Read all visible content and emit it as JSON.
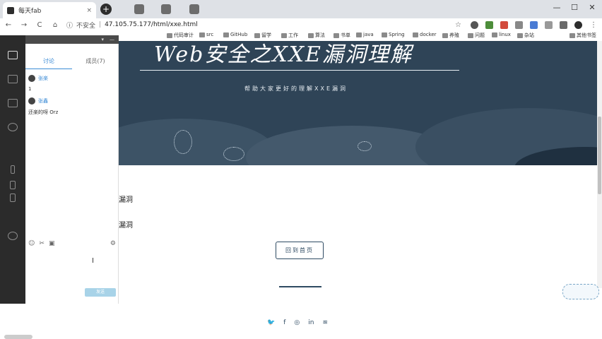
{
  "browser": {
    "tab_title": "每天fab",
    "tab_close": "×",
    "new_tab": "+",
    "window_minimize": "—",
    "window_maximize": "☐",
    "window_close": "✕",
    "nav_back": "←",
    "nav_forward": "→",
    "nav_reload": "C",
    "nav_home": "⌂",
    "security_label": "不安全",
    "url": "47.105.75.177/html/xxe.html"
  },
  "bookmarks": [
    {
      "label": "代码审计"
    },
    {
      "label": "src"
    },
    {
      "label": "GitHub"
    },
    {
      "label": "留学"
    },
    {
      "label": "工作"
    },
    {
      "label": "算法"
    },
    {
      "label": "书单"
    },
    {
      "label": "java"
    },
    {
      "label": "Spring"
    },
    {
      "label": "docker"
    },
    {
      "label": "养殖"
    },
    {
      "label": "问题"
    },
    {
      "label": "linux"
    },
    {
      "label": "杂站"
    },
    {
      "label": "其他书签"
    }
  ],
  "page": {
    "hero_title": "Web安全之XXE漏洞理解",
    "hero_subtitle": "帮助大家更好的理解XXE漏洞",
    "link1": "漏洞",
    "link2": "漏洞",
    "home_button": "回到首页"
  },
  "chat": {
    "tabs": [
      {
        "label": "讨论",
        "active": true
      },
      {
        "label": "成员(7)",
        "active": false
      }
    ],
    "messages": [
      {
        "name": "张楽",
        "text": "1"
      },
      {
        "name": "张鑫",
        "text": "还楽的呀 Orz"
      }
    ],
    "send_label": "发送"
  },
  "colors": {
    "hero_bg": "#2f4457",
    "accent": "#3b8bd6",
    "dock_bg": "#2b2b2b"
  }
}
